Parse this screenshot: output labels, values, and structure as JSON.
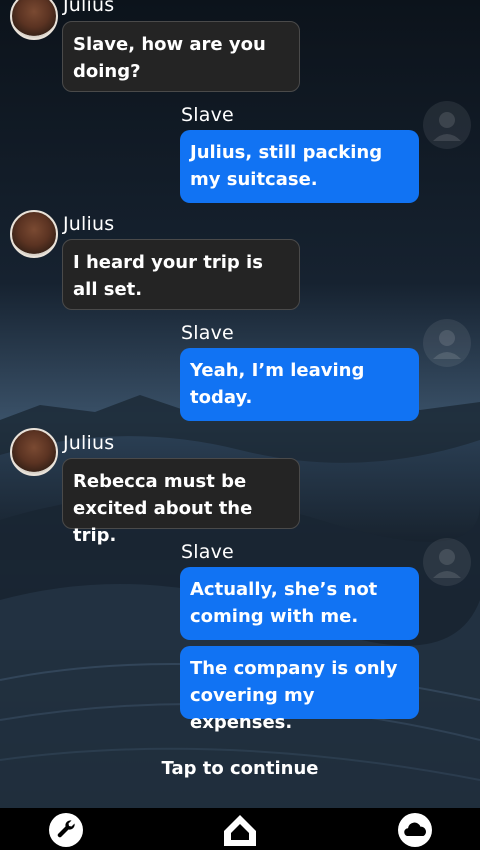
{
  "chat": {
    "messages": [
      {
        "sender": "Julius",
        "text": "Slave, how are you doing?"
      },
      {
        "sender": "Slave",
        "text": "Julius, still packing my suitcase."
      },
      {
        "sender": "Julius",
        "text": "I heard your trip is all set."
      },
      {
        "sender": "Slave",
        "text": "Yeah, I’m leaving today."
      },
      {
        "sender": "Julius",
        "text": "Rebecca must be excited about the trip."
      },
      {
        "sender": "Slave",
        "text": "Actually, she’s not coming with me."
      },
      {
        "sender": "Slave",
        "text": "The company is only covering my expenses."
      }
    ]
  },
  "prompt": {
    "tap_to_continue": "Tap to continue"
  },
  "navbar": {
    "items": [
      {
        "icon": "wrench-icon"
      },
      {
        "icon": "home-icon"
      },
      {
        "icon": "cloud-icon"
      }
    ]
  },
  "colors": {
    "incoming_bubble": "#242424",
    "outgoing_bubble": "#1173f3",
    "navbar": "#000000"
  }
}
